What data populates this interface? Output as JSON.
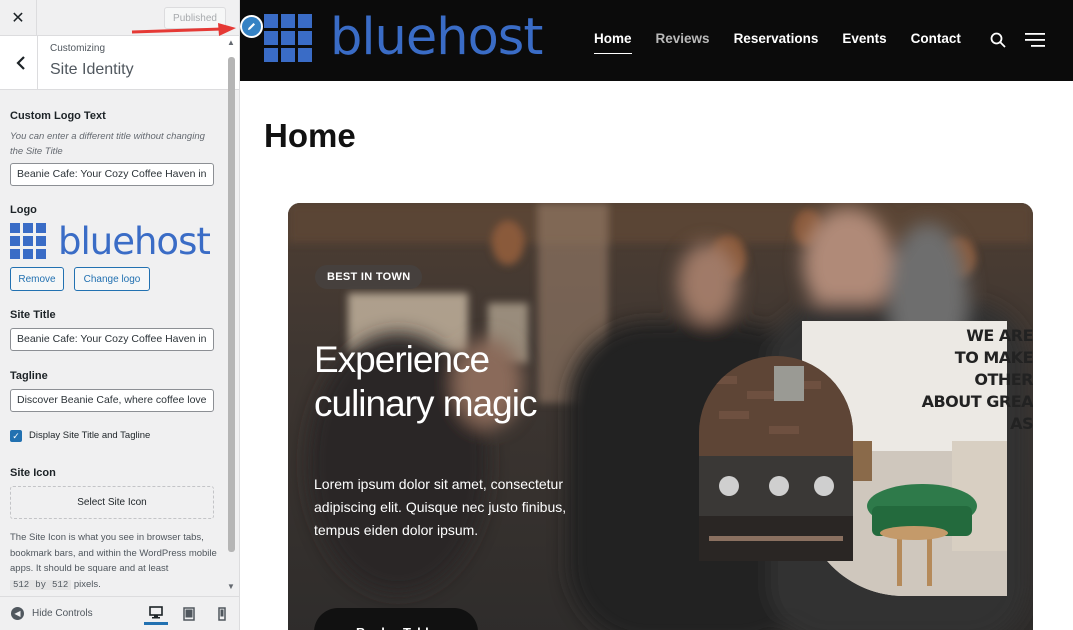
{
  "sidebar": {
    "close_symbol": "✕",
    "publish_button": "Published",
    "breadcrumb": "Customizing",
    "panel_title": "Site Identity",
    "custom_logo_text": {
      "label": "Custom Logo Text",
      "description": "You can enter a different title without changing the Site Title",
      "value": "Beanie Cafe: Your Cozy Coffee Haven in"
    },
    "logo": {
      "label": "Logo",
      "logo_text": "bluehost",
      "remove_button": "Remove",
      "change_button": "Change logo"
    },
    "site_title": {
      "label": "Site Title",
      "value": "Beanie Cafe: Your Cozy Coffee Haven in"
    },
    "tagline": {
      "label": "Tagline",
      "value": "Discover Beanie Cafe, where coffee love"
    },
    "display_title_checkbox": {
      "label": "Display Site Title and Tagline",
      "checked": true
    },
    "site_icon": {
      "label": "Site Icon",
      "select_button": "Select Site Icon",
      "description_1": "The Site Icon is what you see in browser tabs, bookmark bars, and within the WordPress mobile apps. It should be square and at least",
      "code_1": "512",
      "by": "by",
      "code_2": "512",
      "description_2": "pixels."
    },
    "footer": {
      "hide_controls": "Hide Controls",
      "devices": [
        "desktop-icon",
        "tablet-icon",
        "mobile-icon"
      ],
      "active_device": "desktop"
    }
  },
  "preview": {
    "header": {
      "logo_text": "bluehost",
      "nav": [
        {
          "label": "Home",
          "active": true
        },
        {
          "label": "Reviews",
          "active": false
        },
        {
          "label": "Reservations",
          "active": false
        },
        {
          "label": "Events",
          "active": false
        },
        {
          "label": "Contact",
          "active": false
        }
      ]
    },
    "page_title": "Home",
    "hero": {
      "badge": "BEST IN TOWN",
      "title": "Experience culinary magic",
      "text": "Lorem ipsum dolor sit amet, consectetur adipiscing elit. Quisque nec justo finibus, tempus eiden dolor ipsum.",
      "button": "Book a Table",
      "mural_lines": [
        "WE ARE",
        "TO MAKE OTHER",
        "ABOUT GREA",
        "AS"
      ]
    }
  },
  "colors": {
    "brand_blue": "#3a6cc6",
    "wp_blue": "#2271b1",
    "header_bg": "#0b0b0b",
    "annotation_red": "#e53935"
  }
}
